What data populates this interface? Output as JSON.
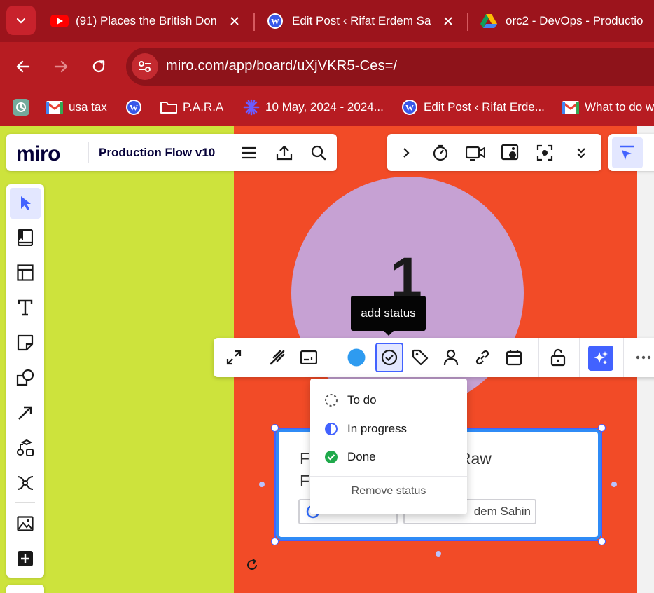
{
  "browser": {
    "tabs": [
      {
        "title": "(91) Places the British Dom",
        "icon": "youtube-icon"
      },
      {
        "title": "Edit Post ‹ Rifat Erdem Sa",
        "icon": "wordpress-icon"
      },
      {
        "title": "orc2 - DevOps - Productio",
        "icon": "google-drive-icon"
      }
    ],
    "url": "miro.com/app/board/uXjVKR5-Ces=/",
    "bookmarks": [
      {
        "label": "",
        "icon": "chatgpt-icon"
      },
      {
        "label": "usa tax",
        "icon": "gmail-icon"
      },
      {
        "label": "",
        "icon": "wordpress-icon"
      },
      {
        "label": "P.A.R.A",
        "icon": "folder-icon"
      },
      {
        "label": "10 May, 2024 - 2024...",
        "icon": "asterisk-icon"
      },
      {
        "label": "Edit Post ‹ Rifat Erde...",
        "icon": "wordpress-icon"
      },
      {
        "label": "What to do w",
        "icon": "gmail-icon"
      }
    ],
    "colors": {
      "tabbar": "#9c141c",
      "toolbar": "#b71c22"
    }
  },
  "miro": {
    "logo": "miro",
    "board_title": "Production Flow v10",
    "circle_number": "1",
    "card": {
      "title_line1_left": "Fl",
      "title_line1_right": "ch Raw",
      "title_line2": "Fo",
      "assignee_chip": "dem Sahin"
    },
    "tooltip": "add status",
    "status_menu": {
      "items": [
        {
          "label": "To do",
          "icon": "todo-dashed-circle-icon"
        },
        {
          "label": "In progress",
          "icon": "half-circle-icon"
        },
        {
          "label": "Done",
          "icon": "check-circle-icon"
        }
      ],
      "remove_label": "Remove status"
    },
    "colors": {
      "lime": "#cde33c",
      "orange": "#f24b27",
      "circle": "#c6a1d3",
      "accent": "#4262ff",
      "card_border": "#2f8bf6",
      "status_color": "#2e9bf0"
    }
  }
}
